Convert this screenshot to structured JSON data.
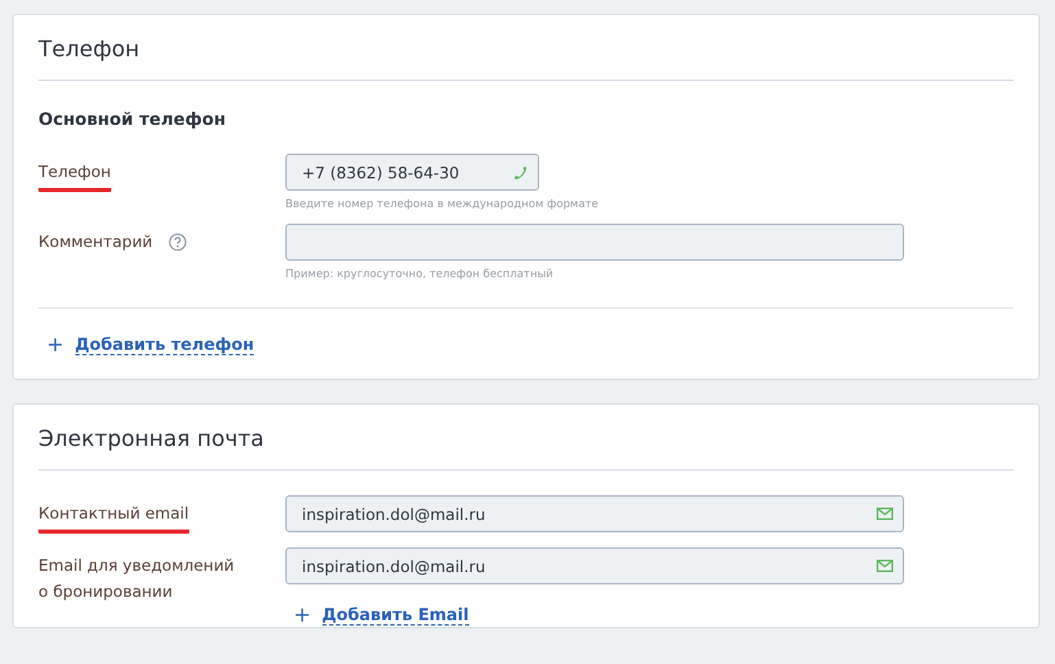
{
  "sections": [
    {
      "title": "Телефон",
      "subtitle": "Основной телефон",
      "fields": [
        {
          "kind": "phone",
          "label": "Телефон",
          "underlined": true,
          "value": "+7 (8362) 58-64-30",
          "hint": "Введите номер телефона в международном формате"
        },
        {
          "kind": "comment",
          "label": "Комментарий",
          "underlined": false,
          "help": true,
          "hint": "Пример: круглосуточно, телефон бесплатный"
        }
      ],
      "add_link": {
        "kind": "footer",
        "plus": "+",
        "label": "Добавить телефон"
      }
    },
    {
      "title": "Электронная почта",
      "fields": [
        {
          "kind": "email",
          "label": "Контактный email",
          "underlined": true,
          "value": "inspiration.dol@mail.ru"
        },
        {
          "kind": "email",
          "label": "Email для уведомлений о бронировании",
          "underlined": false,
          "value": "inspiration.dol@mail.ru"
        }
      ],
      "add_link": {
        "kind": "inline",
        "plus": "+",
        "label": "Добавить Email"
      }
    }
  ]
}
